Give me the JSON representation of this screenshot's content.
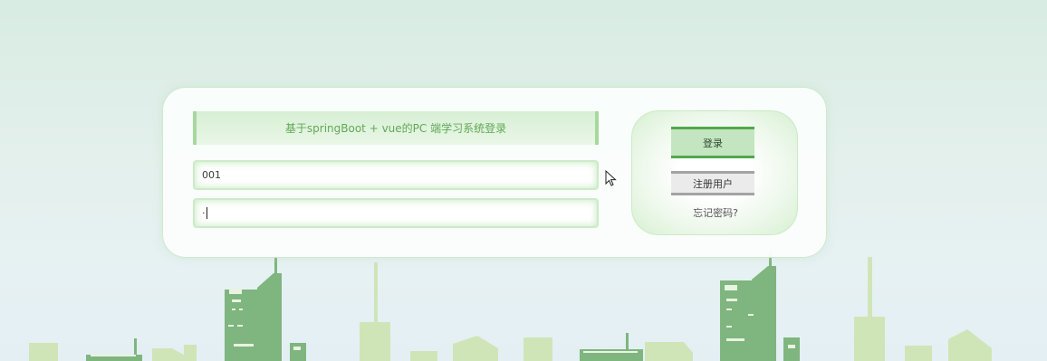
{
  "login": {
    "title": "基于springBoot + vue的PC 端学习系统登录",
    "username_value": "001",
    "password_value": "·",
    "login_label": "登录",
    "register_label": "注册用户",
    "forgot_label": "忘记密码?"
  },
  "colors": {
    "accent": "#52a84c",
    "title_text": "#62a856",
    "building_dark": "#7fb57f",
    "building_light": "#cfe5b7"
  },
  "icons": {
    "mouse_cursor": "mouse-cursor-icon"
  }
}
